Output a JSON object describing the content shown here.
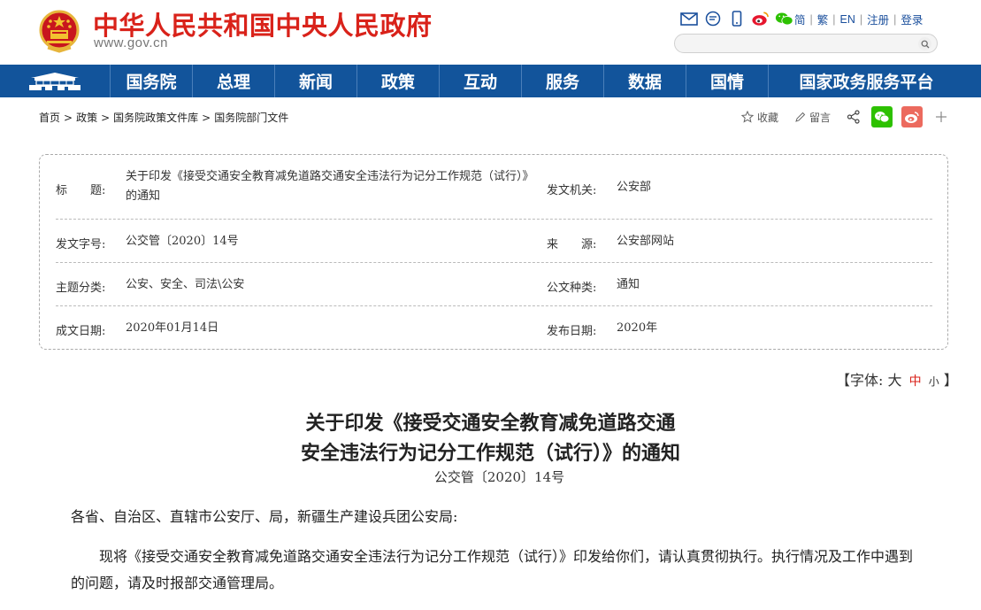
{
  "header": {
    "site_title": "中华人民共和国中央人民政府",
    "site_url": "www.gov.cn",
    "icons": [
      "mail-icon",
      "chat-bubble-icon",
      "mobile-icon",
      "weibo-icon",
      "wechat-icon"
    ],
    "lang_links": [
      "简",
      "繁",
      "EN",
      "注册",
      "登录"
    ],
    "search_placeholder": ""
  },
  "nav": {
    "items": [
      "国务院",
      "总理",
      "新闻",
      "政策",
      "互动",
      "服务",
      "数据",
      "国情",
      "国家政务服务平台"
    ]
  },
  "breadcrumb": [
    "首页",
    "政策",
    "国务院政策文件库",
    "国务院部门文件"
  ],
  "share": {
    "favorite": "收藏",
    "comment": "留言"
  },
  "info": {
    "title_label": "标　　题:",
    "title_value": "关于印发《接受交通安全教育减免道路交通安全违法行为记分工作规范（试行）》的通知",
    "issuer_label": "发文机关:",
    "issuer_value": "公安部",
    "docno_label": "发文字号:",
    "docno_value": "公交管〔2020〕14号",
    "source_label": "来　　源:",
    "source_value": "公安部网站",
    "topic_label": "主题分类:",
    "topic_value": "公安、安全、司法\\公安",
    "type_label": "公文种类:",
    "type_value": "通知",
    "written_label": "成文日期:",
    "written_value": "2020年01月14日",
    "publish_label": "发布日期:",
    "publish_value": "2020年"
  },
  "fontsize": {
    "open": "【字体:",
    "large": "大",
    "medium": "中",
    "small": "小",
    "close": "】"
  },
  "article": {
    "title_line1": "关于印发《接受交通安全教育减免道路交通",
    "title_line2": "安全违法行为记分工作规范（试行）》的通知",
    "doc_number": "公交管〔2020〕14号",
    "salutation": "各省、自治区、直辖市公安厅、局，新疆生产建设兵团公安局:",
    "body": "　　现将《接受交通安全教育减免道路交通安全违法行为记分工作规范（试行）》印发给你们，请认真贯彻执行。执行情况及工作中遇到的问题，请及时报部交通管理局。"
  },
  "colors": {
    "brand_red": "#d9221a",
    "nav_blue": "#12549b",
    "link_blue": "#1a4f9c",
    "wechat_green": "#2dc100",
    "weibo_red": "#e6162d"
  }
}
